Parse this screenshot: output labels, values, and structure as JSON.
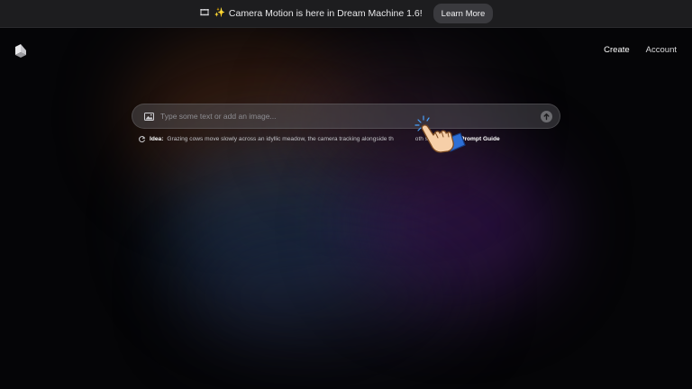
{
  "announcement": {
    "icons": [
      "film-frames-icon",
      "sparkles-icon"
    ],
    "text": "Camera Motion is here in Dream Machine 1.6!",
    "button_label": "Learn More"
  },
  "nav": {
    "logo": "luma-logo-icon",
    "items": [
      {
        "label": "Create"
      },
      {
        "label": "Account"
      }
    ]
  },
  "prompt": {
    "placeholder": "Type some text or add an image...",
    "value": "",
    "left_icon": "image-icon",
    "right_icon": "submit-arrow-icon"
  },
  "idea": {
    "icon": "refresh-icon",
    "label": "Idea:",
    "text": "Grazing cows move slowly across an idyllic meadow, the camera tracking alongside th",
    "text_tail": "oth side-angl...",
    "guide_label": "Prompt Guide"
  },
  "overlay": {
    "cursor_icon": "pointing-hand-cursor-icon"
  },
  "colors": {
    "background": "#050507",
    "announce_bar": "#1d1d1f",
    "button": "#3a3a3e",
    "text_primary": "#ffffff"
  }
}
